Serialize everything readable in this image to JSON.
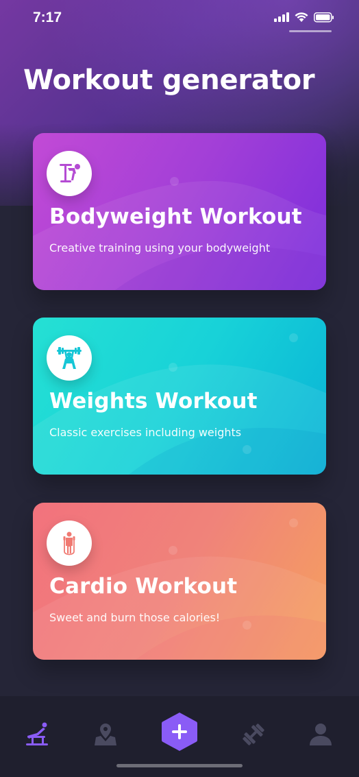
{
  "status_bar": {
    "time": "7:17"
  },
  "page": {
    "title": "Workout generator"
  },
  "cards": [
    {
      "title": "Bodyweight Workout",
      "subtitle": "Creative training using your bodyweight",
      "icon": "bodyweight-exercise-icon",
      "icon_color": "#b44bd3"
    },
    {
      "title": "Weights Workout",
      "subtitle": "Classic exercises including weights",
      "icon": "weightlifting-icon",
      "icon_color": "#16c6d6"
    },
    {
      "title": "Cardio Workout",
      "subtitle": "Sweet and burn those calories!",
      "icon": "jump-rope-icon",
      "icon_color": "#f07a72"
    }
  ],
  "tab_bar": {
    "tabs": [
      "bodyweight-tab",
      "map-tab",
      "add-button",
      "weights-tab",
      "profile-tab"
    ],
    "active_color": "#8a5cf6",
    "inactive_color": "#4a4a60"
  }
}
